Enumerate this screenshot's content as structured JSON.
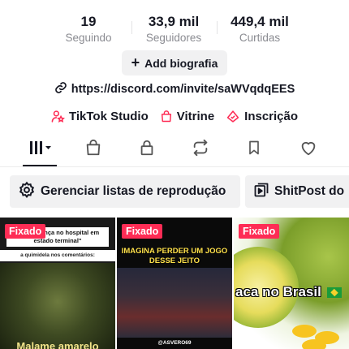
{
  "stats": [
    {
      "value": "19",
      "label": "Seguindo"
    },
    {
      "value": "33,9 mil",
      "label": "Seguidores"
    },
    {
      "value": "449,4 mil",
      "label": "Curtidas"
    }
  ],
  "bio": {
    "add_label": "Add biografia"
  },
  "link": {
    "url": "https://discord.com/invite/saWVqdqEES"
  },
  "shortcuts": [
    {
      "label": "TikTok Studio",
      "icon": "person-star-icon"
    },
    {
      "label": "Vitrine",
      "icon": "shopping-bag-icon"
    },
    {
      "label": "Inscrição",
      "icon": "subscription-icon"
    }
  ],
  "tabs": [
    {
      "icon": "grid-icon",
      "active": true
    },
    {
      "icon": "shopping-bag-icon"
    },
    {
      "icon": "lock-icon"
    },
    {
      "icon": "repost-icon"
    },
    {
      "icon": "bookmark-icon"
    },
    {
      "icon": "heart-icon"
    }
  ],
  "playlists": [
    {
      "label": "Gerenciar listas de reprodução",
      "icon": "gear-icon"
    },
    {
      "label": "ShitPost do",
      "icon": "playlist-icon"
    }
  ],
  "videos": [
    {
      "pinned": "Fixado",
      "caption": "\"uma criança no hospital em estado terminal\"",
      "subcaption": "a quimidela nos comentários:",
      "overlay": "Malame amarelo"
    },
    {
      "pinned": "Fixado",
      "overlay": "IMAGINA PERDER UM JOGO DESSE JEITO",
      "handle": "@ASVERO69"
    },
    {
      "pinned": "Fixado",
      "overlay": "aca no Brasil"
    }
  ],
  "colors": {
    "accent": "#fe2c55",
    "text": "#161823",
    "muted": "#8a8b91",
    "chip_bg": "#f1f1f2"
  }
}
